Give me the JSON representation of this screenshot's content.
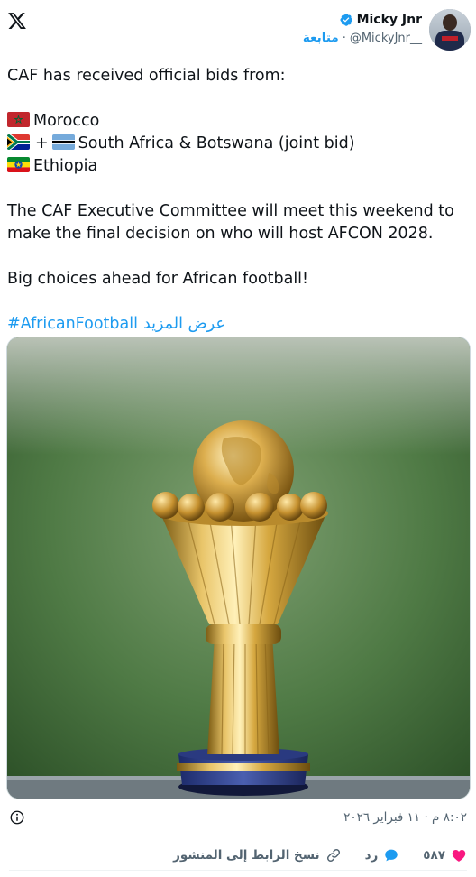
{
  "header": {
    "logo_icon": "x-logo-icon",
    "author_name": "Micky Jnr",
    "verified_icon": "verified-badge-icon",
    "handle": "@MickyJnr__",
    "separator": "·",
    "follow_label": "متابعة",
    "avatar": "user-avatar"
  },
  "tweet": {
    "intro": "CAF has received official bids from:",
    "bids": [
      {
        "flags": [
          "morocco-flag-icon"
        ],
        "text": "Morocco"
      },
      {
        "flags": [
          "south-africa-flag-icon",
          "botswana-flag-icon"
        ],
        "plus": "+",
        "text": "South Africa & Botswana (joint bid)"
      },
      {
        "flags": [
          "ethiopia-flag-icon"
        ],
        "text": "Ethiopia"
      }
    ],
    "paragraph_1": "The CAF Executive Committee will meet this weekend to make the final decision on who will host AFCON 2028.",
    "paragraph_2": "Big choices ahead for African football!",
    "hashtag": "#AfricanFootball",
    "show_more": "عرض المزيد"
  },
  "media": {
    "image": "afcon-trophy-photo"
  },
  "meta": {
    "info_icon": "info-circle-icon",
    "timestamp": "٨:٠٢ م · ١١ فبراير ٢٠٢٦"
  },
  "actions": {
    "likes_count": "٥٨٧",
    "reply_label": "رد",
    "copy_link_label": "نسخ الرابط إلى المنشور"
  },
  "colors": {
    "accent": "#1d9bf0",
    "like": "#f91880",
    "text_secondary": "#536471"
  }
}
